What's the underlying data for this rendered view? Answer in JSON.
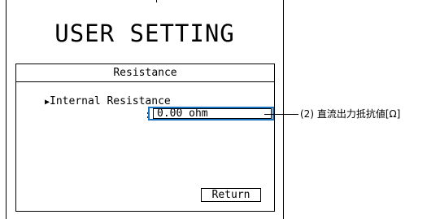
{
  "screen": {
    "title": "USER SETTING",
    "panel": {
      "header": "Resistance",
      "parameter": {
        "caret": "▶",
        "label": "Internal Resistance",
        "colon": ":",
        "value": "0.00 ohm"
      },
      "return_label": "Return"
    }
  },
  "annotation": {
    "text": "(2) 直流出力抵抗値[Ω]"
  },
  "colors": {
    "highlight_border": "#1a73c0",
    "text": "#000000",
    "background": "#ffffff"
  }
}
